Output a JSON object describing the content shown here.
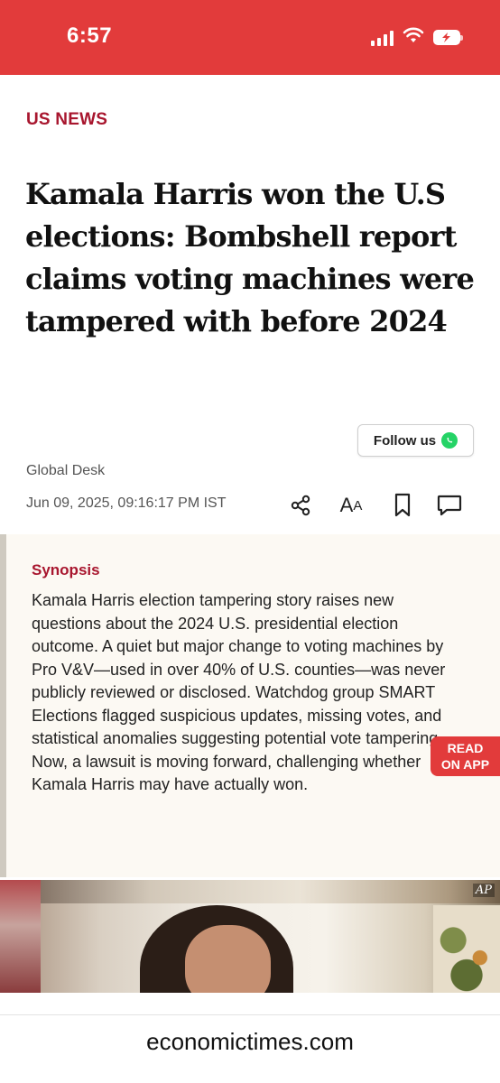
{
  "status_bar": {
    "time": "6:57",
    "background_color": "#e23b3b",
    "icons": [
      "signal-icon",
      "wifi-icon",
      "battery-charging-icon"
    ]
  },
  "article": {
    "category": "US NEWS",
    "headline": "Kamala Harris won the U.S elections: Bombshell report claims voting machines were tampered with before 2024",
    "follow_label": "Follow us",
    "author": "Global Desk",
    "date": "Jun 09, 2025, 09:16:17 PM IST",
    "toolbar_icons": [
      "share-icon",
      "font-size-icon",
      "bookmark-icon",
      "comment-icon"
    ],
    "font_size_glyph_large": "A",
    "font_size_glyph_small": "A"
  },
  "synopsis": {
    "title": "Synopsis",
    "text": "Kamala Harris election tampering story raises new questions about the 2024 U.S. presidential election outcome. A quiet but major change to voting machines by Pro V&V—used in over 40% of U.S. counties—was never publicly reviewed or disclosed. Watchdog group SMART Elections flagged suspicious updates, missing votes, and statistical anomalies suggesting potential vote tampering. Now, a lawsuit is moving forward, challenging whether Kamala Harris may have actually won."
  },
  "read_on_app": {
    "line1": "READ",
    "line2": "ON APP"
  },
  "hero_image": {
    "credit": "AP"
  },
  "browser": {
    "url": "economictimes.com"
  },
  "colors": {
    "accent": "#a8162e",
    "brand_red": "#e23b3b",
    "synopsis_bg": "#fcf9f3",
    "whatsapp_green": "#25d366"
  }
}
